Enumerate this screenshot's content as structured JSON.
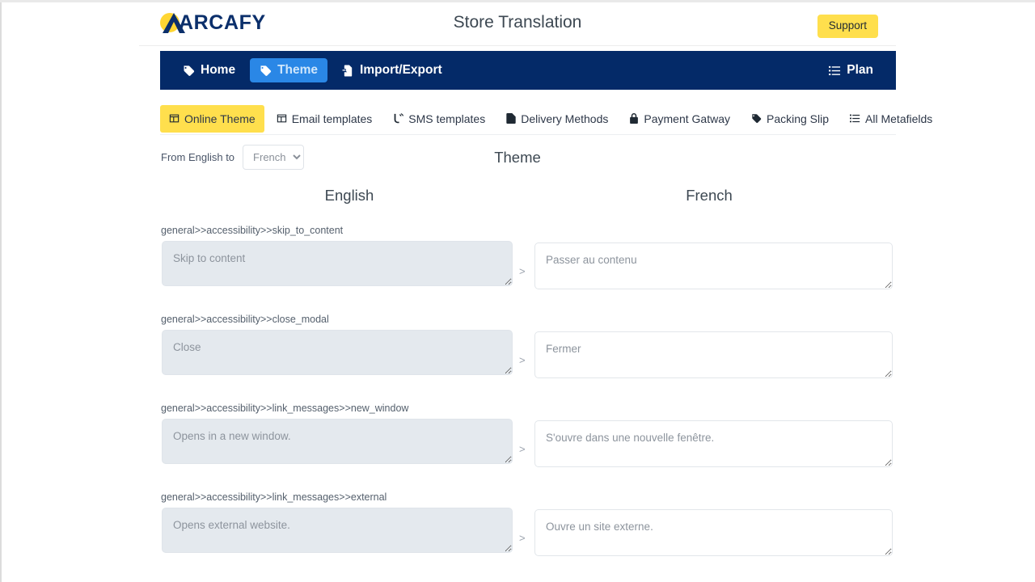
{
  "header": {
    "logo_text": "ARCAFY",
    "logo_icon": "arcafy-logo-mark",
    "title": "Store Translation",
    "support_label": "Support"
  },
  "nav": {
    "items": [
      {
        "label": "Home",
        "icon": "tag-icon",
        "active": false
      },
      {
        "label": "Theme",
        "icon": "tag-icon",
        "active": true
      },
      {
        "label": "Import/Export",
        "icon": "file-import-icon",
        "active": false
      }
    ],
    "right": {
      "label": "Plan",
      "icon": "list-icon"
    },
    "bg_color": "#042a68",
    "active_color": "#2a87e6"
  },
  "subtabs": {
    "accent_color": "#ffdf4d",
    "items": [
      {
        "label": "Online Theme",
        "icon": "window-icon",
        "active": true
      },
      {
        "label": "Email templates",
        "icon": "window-icon",
        "active": false
      },
      {
        "label": "SMS templates",
        "icon": "sms-icon",
        "active": false
      },
      {
        "label": "Delivery Methods",
        "icon": "file-icon",
        "active": false
      },
      {
        "label": "Payment Gatway",
        "icon": "lock-icon",
        "active": false
      },
      {
        "label": "Packing Slip",
        "icon": "tag-icon",
        "active": false
      },
      {
        "label": "All Metafields",
        "icon": "list-icon",
        "active": false
      }
    ]
  },
  "language": {
    "prefix_label": "From English to",
    "selected": "French",
    "options": [
      "French"
    ]
  },
  "section_title": "Theme",
  "columns": {
    "source": "English",
    "target": "French"
  },
  "separator": ">",
  "translations": [
    {
      "key": "general>>accessibility>>skip_to_content",
      "source": "Skip to content",
      "target": "Passer au contenu"
    },
    {
      "key": "general>>accessibility>>close_modal",
      "source": "Close",
      "target": "Fermer"
    },
    {
      "key": "general>>accessibility>>link_messages>>new_window",
      "source": "Opens in a new window.",
      "target": "S'ouvre dans une nouvelle fenêtre."
    },
    {
      "key": "general>>accessibility>>link_messages>>external",
      "source": "Opens external website.",
      "target": "Ouvre un site externe."
    }
  ]
}
